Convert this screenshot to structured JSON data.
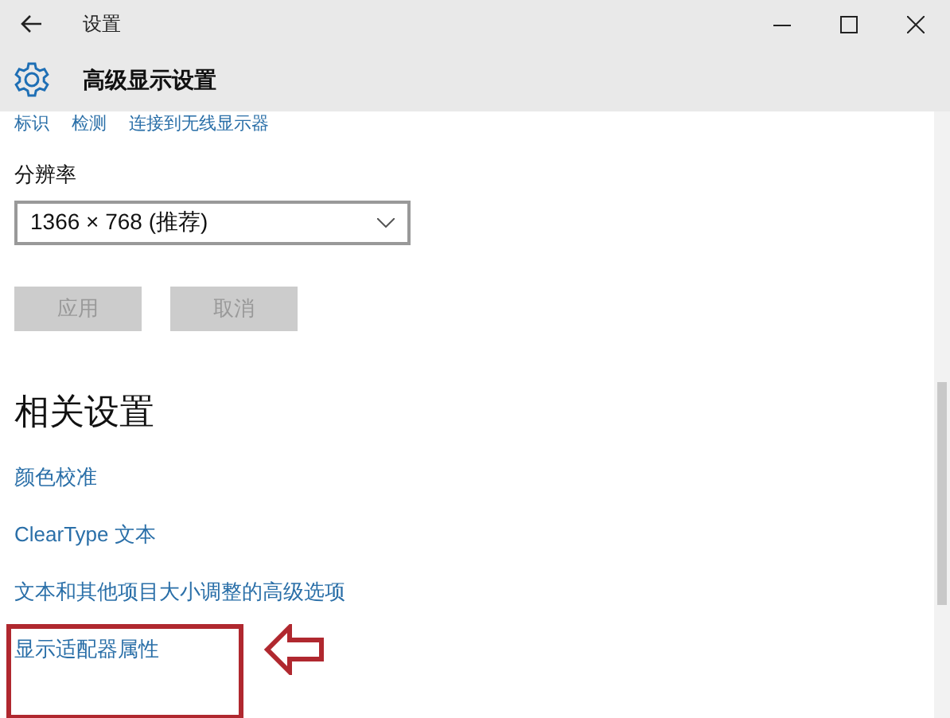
{
  "window": {
    "title": "设置"
  },
  "page": {
    "title": "高级显示设置"
  },
  "top_links": [
    "标识",
    "检测",
    "连接到无线显示器"
  ],
  "resolution": {
    "label": "分辨率",
    "value": "1366 × 768 (推荐)"
  },
  "buttons": [
    {
      "label": "应用",
      "disabled": true
    },
    {
      "label": "取消",
      "disabled": true
    }
  ],
  "related": {
    "heading": "相关设置",
    "links": [
      {
        "label": "颜色校准",
        "highlighted": false
      },
      {
        "label": "ClearType 文本",
        "highlighted": false
      },
      {
        "label": "文本和其他项目大小调整的高级选项",
        "highlighted": false
      },
      {
        "label": "显示适配器属性",
        "highlighted": true
      }
    ]
  }
}
